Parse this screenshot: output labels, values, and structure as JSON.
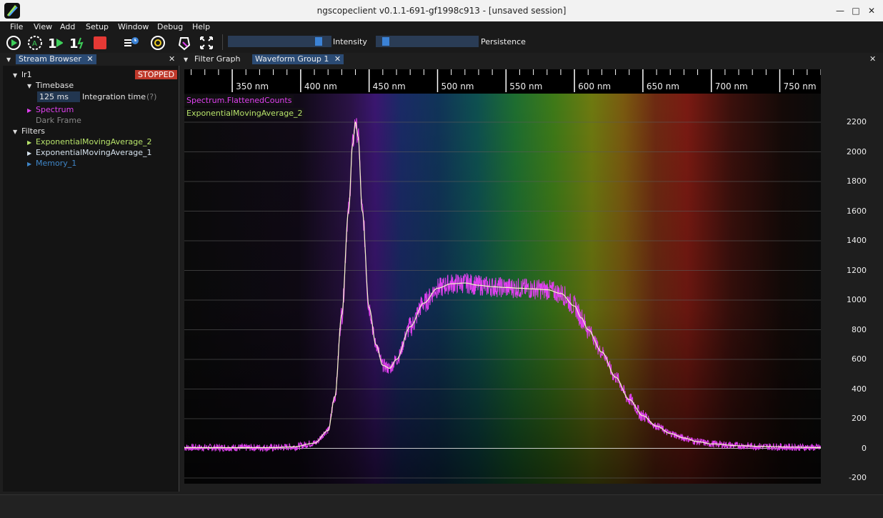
{
  "window": {
    "title": "ngscopeclient v0.1.1-691-gf1998c913  - [unsaved session]"
  },
  "menu": [
    "File",
    "View",
    "Add",
    "Setup",
    "Window",
    "Debug",
    "Help"
  ],
  "toolbar": {
    "intensity_label": "Intensity",
    "persistence_label": "Persistence",
    "intensity_level": 0.92,
    "persistence_level": 0.05
  },
  "stream_browser": {
    "tab_label": "Stream Browser",
    "instrument": "lr1",
    "status": "STOPPED",
    "timebase_label": "Timebase",
    "integration_value": "125 ms",
    "integration_label": "Integration time",
    "help": "(?)",
    "spectrum_label": "Spectrum",
    "dark_frame_label": "Dark Frame",
    "filters_label": "Filters",
    "filters": [
      {
        "name": "ExponentialMovingAverage_2",
        "color": "#b7e36a"
      },
      {
        "name": "ExponentialMovingAverage_1",
        "color": "#d7e3ef"
      },
      {
        "name": "Memory_1",
        "color": "#3f86c8"
      }
    ]
  },
  "tabs": {
    "filter_graph": "Filter Graph",
    "waveform_group": "Waveform Group 1"
  },
  "series_labels": {
    "spectrum": "Spectrum.FlattenedCounts",
    "ema": "ExponentialMovingAverage_2"
  },
  "chart_data": {
    "type": "line",
    "x_range_nm": [
      315,
      780
    ],
    "x_ticks": [
      "350 nm",
      "400 nm",
      "450 nm",
      "500 nm",
      "550 nm",
      "600 nm",
      "650 nm",
      "700 nm",
      "750 nm"
    ],
    "x_tick_values": [
      350,
      400,
      450,
      500,
      550,
      600,
      650,
      700,
      750
    ],
    "y_range": [
      -200,
      2200
    ],
    "y_ticks": [
      "2200",
      "2000",
      "1800",
      "1600",
      "1400",
      "1200",
      "1000",
      "800",
      "600",
      "400",
      "200",
      "0",
      "-200"
    ],
    "y_tick_values": [
      2200,
      2000,
      1800,
      1600,
      1400,
      1200,
      1000,
      800,
      600,
      400,
      200,
      0,
      -200
    ],
    "series": [
      {
        "name": "Spectrum.FlattenedCounts",
        "color": "#e040f0"
      },
      {
        "name": "ExponentialMovingAverage_2",
        "color": "#f4f7c8"
      }
    ],
    "x": [
      315,
      380,
      395,
      410,
      420,
      425,
      430,
      435,
      438,
      440,
      442,
      445,
      450,
      455,
      460,
      465,
      470,
      480,
      490,
      500,
      510,
      520,
      530,
      540,
      550,
      560,
      570,
      580,
      590,
      600,
      605,
      610,
      620,
      630,
      640,
      650,
      660,
      670,
      680,
      690,
      700,
      720,
      740,
      760,
      780
    ],
    "y": [
      5,
      5,
      10,
      35,
      120,
      350,
      900,
      1600,
      2050,
      2200,
      2100,
      1600,
      950,
      700,
      560,
      540,
      600,
      820,
      980,
      1080,
      1110,
      1115,
      1100,
      1090,
      1085,
      1080,
      1075,
      1070,
      1045,
      960,
      880,
      800,
      650,
      480,
      330,
      220,
      150,
      100,
      70,
      45,
      30,
      18,
      12,
      8,
      5
    ]
  }
}
